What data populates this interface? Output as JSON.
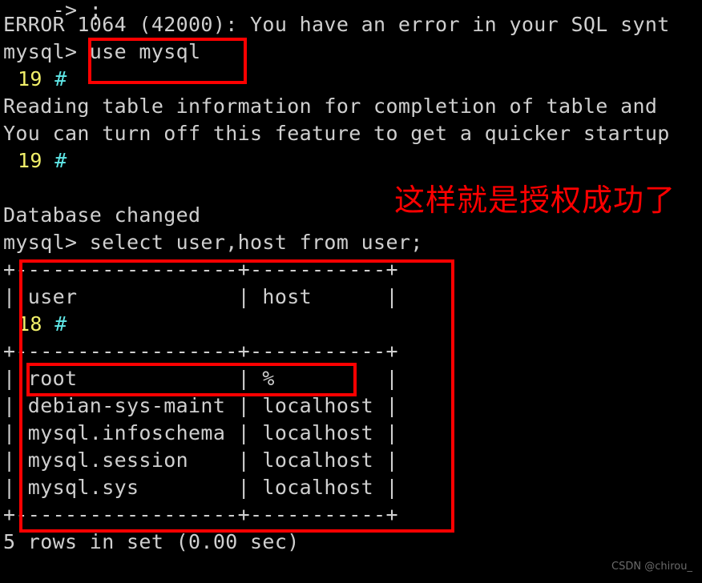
{
  "terminal": {
    "background_color": "#000000",
    "text_color": "#cfcfcf",
    "lines": [
      {
        "id": "l0",
        "text": "    -> ;"
      },
      {
        "id": "l1",
        "text": "ERROR 1064 (42000): You have an error in your SQL synt"
      },
      {
        "id": "l2",
        "text": "mysql> use mysql"
      },
      {
        "id": "l3",
        "text": "Reading table information for completion of table and"
      },
      {
        "id": "l4",
        "text": "You can turn off this feature to get a quicker startup"
      },
      {
        "id": "l5",
        "text": "Database changed"
      },
      {
        "id": "l6",
        "text": "mysql> select user,host from user;"
      },
      {
        "id": "l7",
        "text": "+------------------+-----------+"
      },
      {
        "id": "l8",
        "text": "| user             | host      |"
      },
      {
        "id": "l9",
        "text": "+------------------+-----------+"
      },
      {
        "id": "l10",
        "text": "| root             | %         |"
      },
      {
        "id": "l11",
        "text": "| debian-sys-maint | localhost |"
      },
      {
        "id": "l12",
        "text": "| mysql.infoschema | localhost |"
      },
      {
        "id": "l13",
        "text": "| mysql.session    | localhost |"
      },
      {
        "id": "l14",
        "text": "| mysql.sys        | localhost |"
      },
      {
        "id": "l15",
        "text": "+------------------+-----------+"
      },
      {
        "id": "l16",
        "text": "5 rows in set (0.00 sec)"
      }
    ]
  },
  "result_table": {
    "type": "table",
    "columns": [
      "user",
      "host"
    ],
    "rows": [
      [
        "root",
        "%"
      ],
      [
        "debian-sys-maint",
        "localhost"
      ],
      [
        "mysql.infoschema",
        "localhost"
      ],
      [
        "mysql.session",
        "localhost"
      ],
      [
        "mysql.sys",
        "localhost"
      ]
    ],
    "footer": "5 rows in set (0.00 sec)"
  },
  "overlay_gutter": [
    {
      "id": "g0",
      "number": "19",
      "marker": "#",
      "number_color": "#f2f06a",
      "marker_color": "#5fe7e7"
    },
    {
      "id": "g1",
      "number": "19",
      "marker": "#",
      "number_color": "#f2f06a",
      "marker_color": "#5fe7e7"
    },
    {
      "id": "g2",
      "number": "18",
      "marker": "#",
      "number_color": "#f2f06a",
      "marker_color": "#5fe7e7"
    }
  ],
  "annotations": {
    "color": "#ff0000",
    "chinese_note": "这样就是授权成功了",
    "boxes": [
      {
        "id": "box-use-mysql",
        "label": "use mysql command highlight"
      },
      {
        "id": "box-result-set",
        "label": "result set highlight"
      },
      {
        "id": "box-root-row",
        "label": "root row highlight"
      }
    ]
  },
  "watermark": {
    "text": "CSDN @chirou_"
  }
}
